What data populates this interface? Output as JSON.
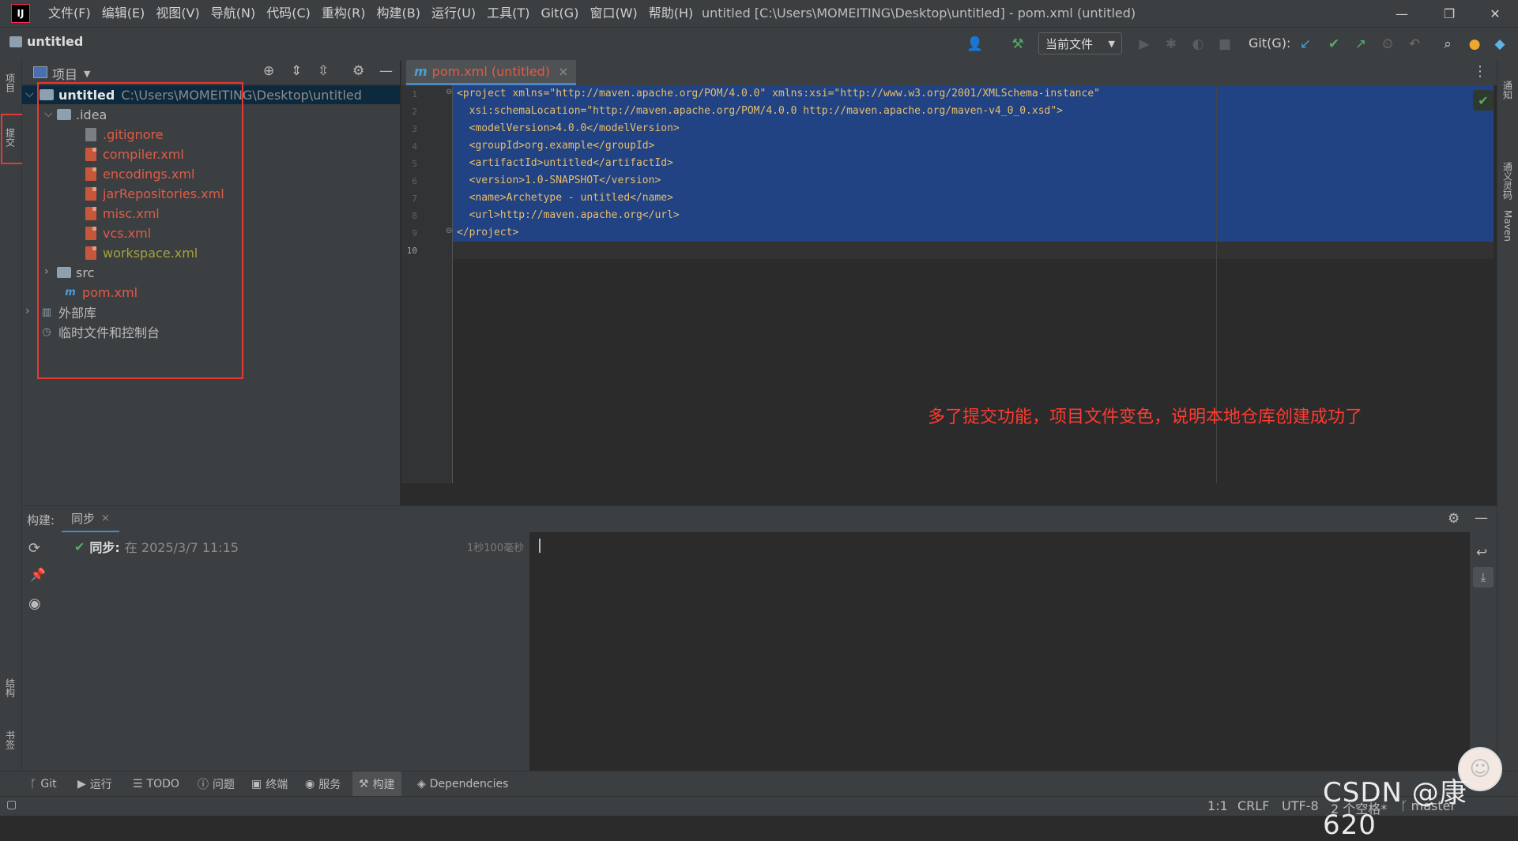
{
  "window": {
    "title": "untitled [C:\\Users\\MOMEITING\\Desktop\\untitled] - pom.xml (untitled)",
    "logo": "IJ",
    "minimize": "—",
    "maximize": "❐",
    "close": "✕"
  },
  "menu": [
    "文件(F)",
    "编辑(E)",
    "视图(V)",
    "导航(N)",
    "代码(C)",
    "重构(R)",
    "构建(B)",
    "运行(U)",
    "工具(T)",
    "Git(G)",
    "窗口(W)",
    "帮助(H)"
  ],
  "nav": {
    "project_name": "untitled",
    "run_config": "当前文件",
    "git_label": "Git(G):"
  },
  "left_stripe": {
    "project": "项目",
    "commit": "提交",
    "structure": "结构",
    "bookmarks": "书签"
  },
  "right_stripe": {
    "notifications": "通知",
    "ai": "通义灵码",
    "maven": "Maven"
  },
  "project_panel": {
    "title": "项目",
    "root": {
      "name": "untitled",
      "path": "C:\\Users\\MOMEITING\\Desktop\\untitled"
    },
    "idea_folder": ".idea",
    "idea_files": [
      {
        "name": ".gitignore",
        "color": "#e05b47"
      },
      {
        "name": "compiler.xml",
        "color": "#e05b47"
      },
      {
        "name": "encodings.xml",
        "color": "#e05b47"
      },
      {
        "name": "jarRepositories.xml",
        "color": "#e05b47"
      },
      {
        "name": "misc.xml",
        "color": "#e05b47"
      },
      {
        "name": "vcs.xml",
        "color": "#e05b47"
      },
      {
        "name": "workspace.xml",
        "color": "#a4a13a"
      }
    ],
    "src_folder": "src",
    "pom": "pom.xml",
    "external_libs": "外部库",
    "scratches": "临时文件和控制台"
  },
  "editor": {
    "tab_label": "pom.xml (untitled)",
    "tab_close": "×",
    "line_numbers": [
      "1",
      "2",
      "3",
      "4",
      "5",
      "6",
      "7",
      "8",
      "9",
      "10"
    ],
    "lines": [
      "<project xmlns=\"http://maven.apache.org/POM/4.0.0\" xmlns:xsi=\"http://www.w3.org/2001/XMLSchema-instance\"",
      "  xsi:schemaLocation=\"http://maven.apache.org/POM/4.0.0 http://maven.apache.org/maven-v4_0_0.xsd\">",
      "  <modelVersion>4.0.0</modelVersion>",
      "  <groupId>org.example</groupId>",
      "  <artifactId>untitled</artifactId>",
      "  <version>1.0-SNAPSHOT</version>",
      "  <name>Archetype - untitled</name>",
      "  <url>http://maven.apache.org</url>",
      "</project>",
      ""
    ],
    "annotation": "多了提交功能，项目文件变色，说明本地仓库创建成功了"
  },
  "build": {
    "label": "构建:",
    "tab": "同步",
    "tab_close": "×",
    "sync_label": "同步:",
    "sync_time": "在 2025/3/7 11:15",
    "duration": "1秒100毫秒"
  },
  "tool_windows": [
    "Git",
    "运行",
    "TODO",
    "问题",
    "终端",
    "服务",
    "构建",
    "Dependencies"
  ],
  "status": {
    "position": "1:1",
    "line_sep": "CRLF",
    "encoding": "UTF-8",
    "indent": "2 个空格*",
    "branch": "master"
  },
  "watermark": "CSDN @康620"
}
